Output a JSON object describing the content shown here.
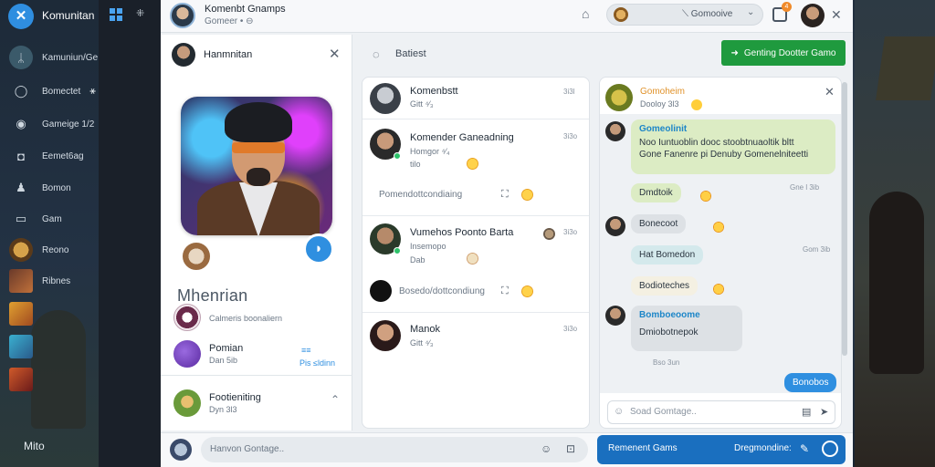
{
  "app": {
    "name": "Komunitan"
  },
  "rail": {
    "items": [
      {
        "label": "Kamuniun/Ge",
        "trailing": "♀",
        "icon": "users-icon"
      },
      {
        "label": "Bomectet",
        "trailing": "⚹",
        "icon": "circle-icon"
      },
      {
        "label": "Gameige 1/2",
        "trailing": "Q",
        "icon": "gamepad-icon"
      },
      {
        "label": "Eemet6ag",
        "trailing": "",
        "icon": "bag-icon"
      },
      {
        "label": "Bomon",
        "trailing": "",
        "icon": "person-icon"
      },
      {
        "label": "Gam",
        "trailing": "",
        "icon": "folder-icon"
      },
      {
        "label": "Reono",
        "trailing": "",
        "icon": "game-thumb-icon"
      },
      {
        "label": "Ribnes",
        "trailing": "",
        "icon": "game-thumb-icon"
      }
    ],
    "bottom_label": "Mito"
  },
  "topbar": {
    "title": "Komenbt Gnamps",
    "subtitle": "Gomeer • ⊖",
    "search_text": "⟍ Gomooive",
    "notification_count": "4"
  },
  "profile": {
    "header_name": "Hanmnitan",
    "display_name": "Mhenrian",
    "rows": [
      {
        "title": "",
        "subtitle": "Calmeris boonaliern"
      },
      {
        "title": "Pomian",
        "subtitle": "Dan 5ib"
      },
      {
        "title": "Footieniting",
        "subtitle": "Dyn 3l3"
      }
    ],
    "link_top": "≡≡",
    "link_bottom": "Pis ≤ldinn"
  },
  "list_header": "Batiest",
  "conversations": [
    {
      "name": "Komenbstt",
      "sub": "Gitt ⁴⁄₃",
      "time": "3i3l",
      "line2": ""
    },
    {
      "name": "Komender Ganeadning",
      "sub": "Homgor ⁴⁄₄",
      "sub2": "tilo",
      "time": "3i3o",
      "line2": "Pomendottcondiaing"
    },
    {
      "name": "Vumehos Poonto Barta",
      "sub": "Insemopo",
      "sub2": "Dab",
      "time": "3i3o",
      "line2": "Bosedo/dottcondiung"
    },
    {
      "name": "Manok",
      "sub": "Gitt ⁴⁄₃",
      "time": "3i3o",
      "line2": ""
    }
  ],
  "chat": {
    "header_name": "Gomoheim",
    "header_sub": "Dooloy 3l3",
    "bubble1_name": "Gomeolinit",
    "bubble1_line1": "Noo Iuntuoblin dooc stoobtnuaoltik bltt",
    "bubble1_line2": "Gone Fanenre pi Denuby Gomenelniteetti",
    "ts1": "Gne l 3ib",
    "bubble2": "Dmdtoik",
    "bubble3": "Bonecoot",
    "ts2": "Gom 3ib",
    "bubble4": "Hat Bomedon",
    "bubble5": "Bodioteches",
    "bubble6_name": "Bomboeoome",
    "bubble6_line": "Dmiobotnepok",
    "ts3": "Bso 3un",
    "bubble7": "Bonobos",
    "input_placeholder": "Soad Gomtage.."
  },
  "green_button": "Genting Dootter Gamo",
  "bottom": {
    "input_placeholder": "Hanvon Gontage..",
    "blue_left": "Remenent Gams",
    "blue_right": "Dregmondine:"
  },
  "colors": {
    "accent": "#2f8fe0",
    "green": "#1f9a3e",
    "bottom_bar": "#1a6fbf"
  }
}
